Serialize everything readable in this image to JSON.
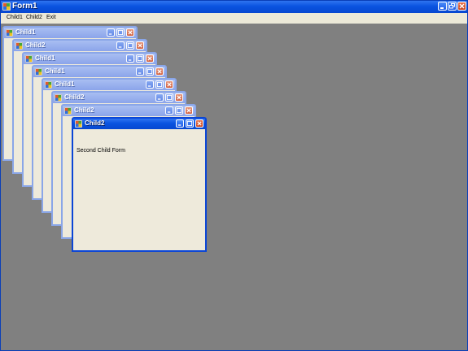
{
  "window": {
    "title": "Form1",
    "menu": [
      {
        "label": "Child1"
      },
      {
        "label": "Child2"
      },
      {
        "label": "Exit"
      }
    ]
  },
  "children": [
    {
      "title": "Child1"
    },
    {
      "title": "Child2"
    },
    {
      "title": "Child1"
    },
    {
      "title": "Child1"
    },
    {
      "title": "Child1"
    },
    {
      "title": "Child2"
    },
    {
      "title": "Child2"
    },
    {
      "title": "Child2",
      "active": true,
      "label": "Second Child Form"
    }
  ],
  "icons": {
    "app": "app-icon",
    "minimize": "minimize-icon",
    "maximize": "maximize-icon",
    "restore": "restore-icon",
    "close": "close-icon"
  },
  "colors": {
    "titlebar_active": "#0a53e0",
    "titlebar_inactive": "#8ba4ea",
    "mdi_background": "#808080",
    "client": "#eeeadb"
  }
}
